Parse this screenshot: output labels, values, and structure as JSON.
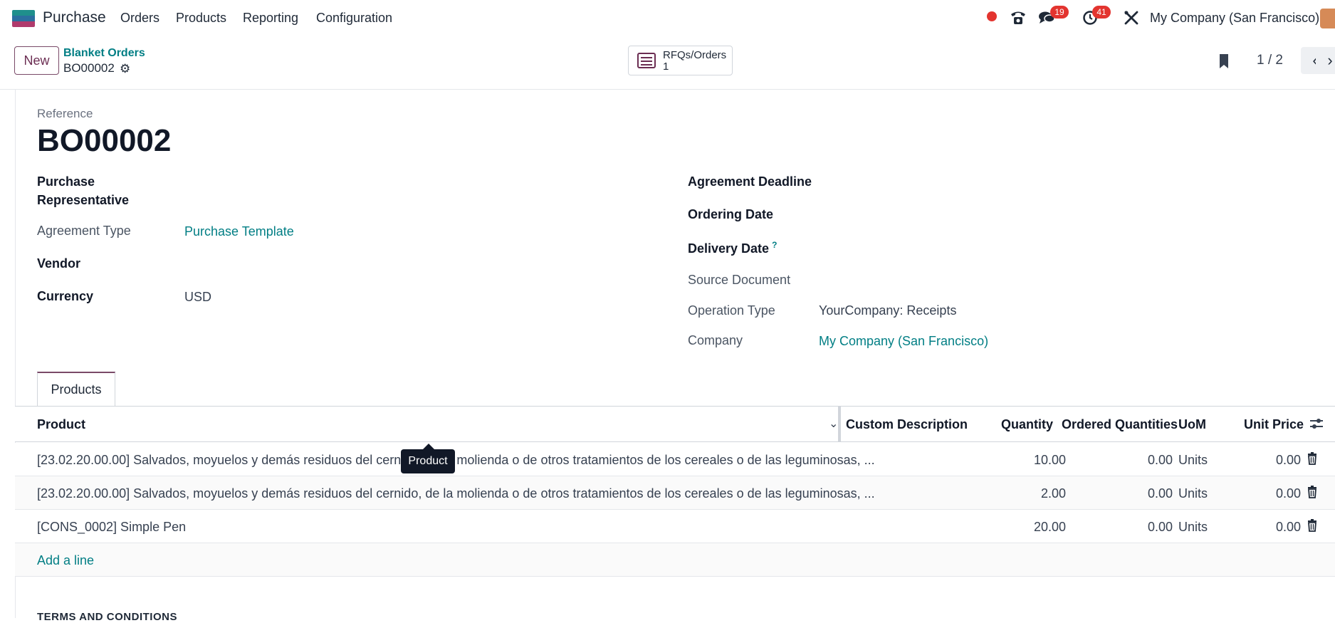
{
  "navbar": {
    "app_name": "Purchase",
    "menu": [
      "Orders",
      "Products",
      "Reporting",
      "Configuration"
    ],
    "messages_badge": "19",
    "activities_badge": "41",
    "company": "My Company (San Francisco)"
  },
  "control": {
    "new_label": "New",
    "breadcrumb_parent": "Blanket Orders",
    "breadcrumb_current": "BO00002",
    "smart_label": "RFQs/Orders",
    "smart_value": "1",
    "pager": "1 / 2"
  },
  "form": {
    "reference_label": "Reference",
    "reference_value": "BO00002",
    "purchase_rep_label_1": "Purchase",
    "purchase_rep_label_2": "Representative",
    "agreement_type_label": "Agreement Type",
    "agreement_type_value": "Purchase Template",
    "vendor_label": "Vendor",
    "currency_label": "Currency",
    "currency_value": "USD",
    "agreement_deadline_label": "Agreement Deadline",
    "ordering_date_label": "Ordering Date",
    "delivery_date_label": "Delivery Date",
    "delivery_help": "?",
    "source_document_label": "Source Document",
    "operation_type_label": "Operation Type",
    "operation_type_value": "YourCompany: Receipts",
    "company_label": "Company",
    "company_value": "My Company (San Francisco)"
  },
  "notebook": {
    "tab_products": "Products",
    "headers": {
      "product": "Product",
      "custom_description": "Custom Description",
      "quantity": "Quantity",
      "ordered_quantities": "Ordered Quantities",
      "uom": "UoM",
      "unit_price": "Unit Price"
    },
    "rows": [
      {
        "product": "[23.02.20.00.00] Salvados, moyuelos y demás residuos del cernido, de la molienda o de otros tratamientos de los cereales o de las leguminosas, ...",
        "quantity": "10.00",
        "ordered": "0.00",
        "uom": "Units",
        "price": "0.00"
      },
      {
        "product": "[23.02.20.00.00] Salvados, moyuelos y demás residuos del cernido, de la molienda o de otros tratamientos de los cereales o de las leguminosas, ...",
        "quantity": "2.00",
        "ordered": "0.00",
        "uom": "Units",
        "price": "0.00"
      },
      {
        "product": "[CONS_0002] Simple Pen",
        "quantity": "20.00",
        "ordered": "0.00",
        "uom": "Units",
        "price": "0.00"
      }
    ],
    "add_line": "Add a line",
    "tooltip": "Product"
  },
  "terms_title": "TERMS AND CONDITIONS"
}
